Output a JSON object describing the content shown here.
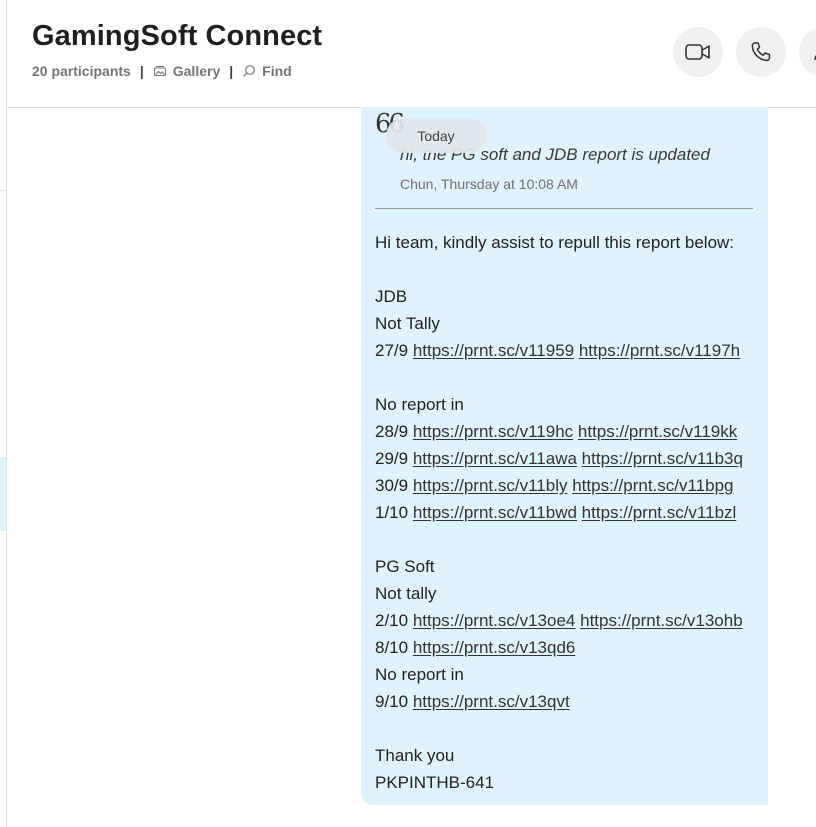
{
  "header": {
    "title": "GamingSoft Connect",
    "participants": "20 participants",
    "gallery_label": "Gallery",
    "find_label": "Find",
    "separator": "|",
    "icons": [
      "video-call-icon",
      "phone-call-icon",
      "add-people-icon"
    ]
  },
  "date_divider": "Today",
  "quote": {
    "mark": "66",
    "text": "hi, the PG soft and JDB report is updated",
    "meta": "Chun, Thursday at 10:08 AM"
  },
  "message": {
    "line1": "Hi team, kindly assist to repull this report below:",
    "line3": "JDB",
    "line4": "Not Tally",
    "line5": {
      "date": "27/9",
      "link1": "https://prnt.sc/v11959",
      "link2": "https://prnt.sc/v1197h"
    },
    "line7": "No report in",
    "line8": {
      "date": "28/9",
      "link1": "https://prnt.sc/v119hc",
      "link2": "https://prnt.sc/v119kk"
    },
    "line9": {
      "date": "29/9",
      "link1": "https://prnt.sc/v11awa",
      "link2": "https://prnt.sc/v11b3q"
    },
    "line10": {
      "date": "30/9",
      "link1": "https://prnt.sc/v11bly",
      "link2": "https://prnt.sc/v11bpg"
    },
    "line11": {
      "date": "1/10",
      "link1": "https://prnt.sc/v11bwd",
      "link2": "https://prnt.sc/v11bzl"
    },
    "line13": "PG Soft",
    "line14": "Not tally",
    "line15": {
      "date": "2/10",
      "link1": "https://prnt.sc/v13oe4",
      "link2": "https://prnt.sc/v13ohb"
    },
    "line16": {
      "date": "8/10",
      "link1": "https://prnt.sc/v13qd6"
    },
    "line17": "No report in",
    "line18": {
      "date": "9/10",
      "link1": "https://prnt.sc/v13qvt"
    },
    "line20": "Thank you",
    "line21": "PKPINTHB-641"
  },
  "colors": {
    "bubble_bg": "#dff3fd",
    "button_bg": "#f0f0f0",
    "pill_bg": "#e2e8ec"
  }
}
